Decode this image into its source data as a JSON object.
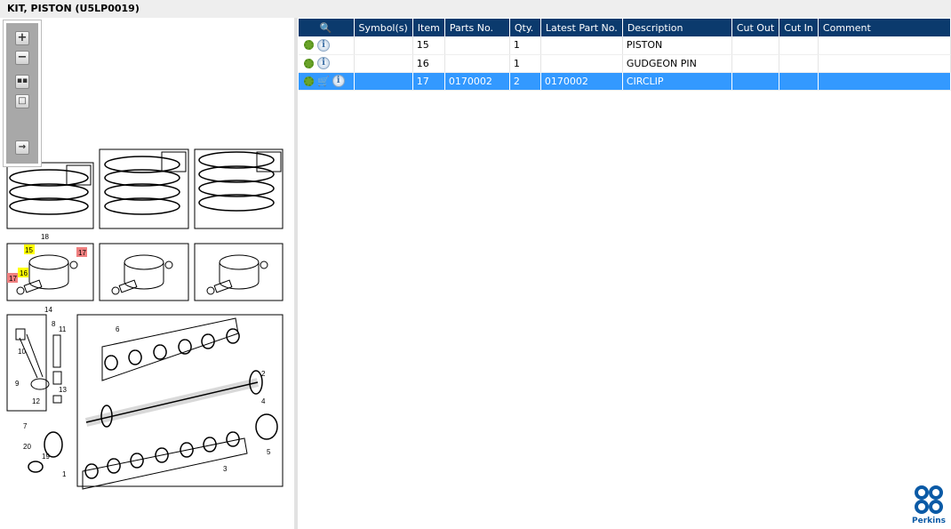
{
  "title": "KIT, PISTON (U5LP0019)",
  "toolbar": {
    "zoom_in": "+",
    "zoom_out": "−"
  },
  "table": {
    "columns": [
      "Symbol(s)",
      "Item",
      "Parts No.",
      "Qty.",
      "Latest Part No.",
      "Description",
      "Cut Out",
      "Cut In",
      "Comment"
    ],
    "rows": [
      {
        "item": "15",
        "parts_no": "",
        "qty": "1",
        "latest": "",
        "description": "PISTON",
        "cart": false,
        "selected": false
      },
      {
        "item": "16",
        "parts_no": "",
        "qty": "1",
        "latest": "",
        "description": "GUDGEON PIN",
        "cart": false,
        "selected": false
      },
      {
        "item": "17",
        "parts_no": "0170002",
        "qty": "2",
        "latest": "0170002",
        "description": "CIRCLIP",
        "cart": true,
        "selected": true
      }
    ]
  },
  "diagram": {
    "callouts": [
      "18",
      "15",
      "17",
      "16",
      "17",
      "14",
      "8",
      "11",
      "10",
      "9",
      "13",
      "12",
      "7",
      "20",
      "19",
      "1",
      "6",
      "2",
      "4",
      "5",
      "3"
    ]
  },
  "logo": {
    "text": "Perkins"
  },
  "colors": {
    "header": "#0b3a6d",
    "selected": "#3399ff",
    "highlight_yellow": "#ffff00",
    "highlight_red": "#f08080"
  }
}
